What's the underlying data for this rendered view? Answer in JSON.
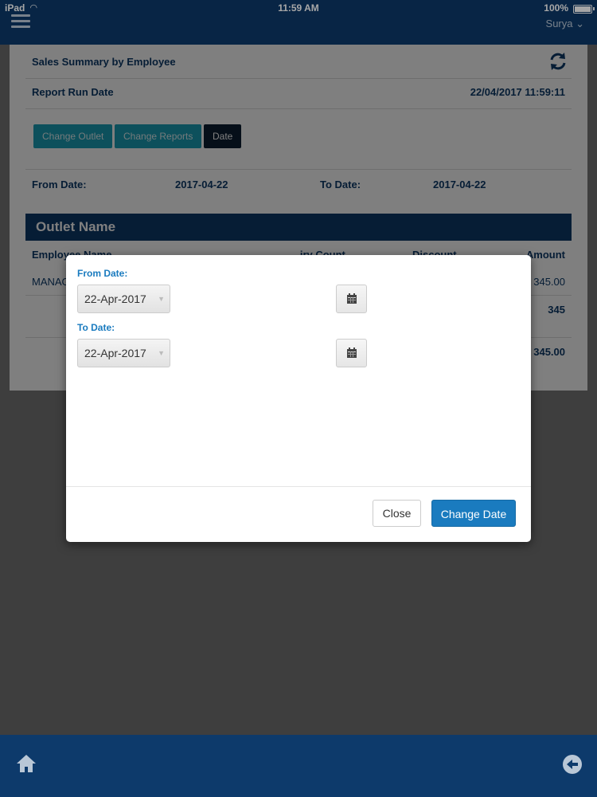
{
  "status_bar": {
    "carrier": "iPad",
    "time": "11:59 AM",
    "battery": "100%"
  },
  "header": {
    "user": "Surya ⌄"
  },
  "report": {
    "title": "Sales Summary by Employee",
    "run_label": "Report Run Date",
    "run_value": "22/04/2017 11:59:11",
    "buttons": {
      "change_outlet": "Change Outlet",
      "change_reports": "Change Reports",
      "date": "Date"
    },
    "from_label": "From Date:",
    "from_value": "2017-04-22",
    "to_label": "To Date:",
    "to_value": "2017-04-22",
    "outlet_header": "Outlet Name",
    "columns": {
      "employee": "Employee Name",
      "count": "...iry Count",
      "discount": "Discount",
      "amount": "Amount"
    },
    "rows": [
      {
        "employee": "MANAG",
        "amount": "345.00"
      }
    ],
    "subtotal": "345",
    "total": "345.00"
  },
  "modal": {
    "from_label": "From Date:",
    "from_value": "22-Apr-2017",
    "to_label": "To Date:",
    "to_value": "22-Apr-2017",
    "close_label": "Close",
    "change_label": "Change Date"
  },
  "colors": {
    "navy": "#0d3a6b",
    "teal": "#1aa0b8",
    "primary": "#1a7bbf"
  },
  "icons": [
    "menu-icon",
    "refresh-icon",
    "calendar-icon",
    "home-icon",
    "back-icon"
  ]
}
